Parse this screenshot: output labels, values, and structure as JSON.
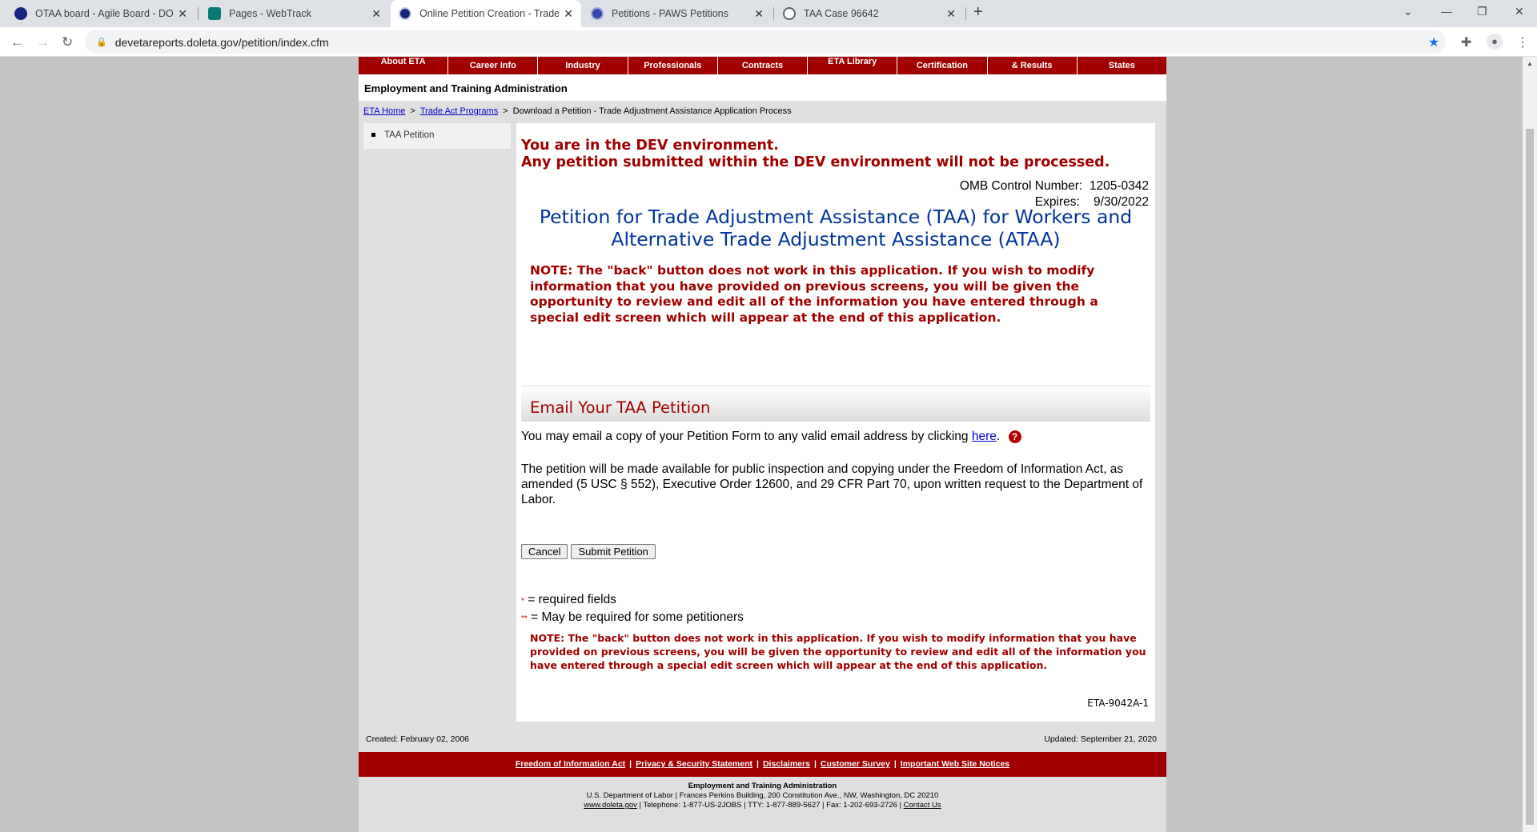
{
  "browser": {
    "tabs": [
      {
        "title": "OTAA board - Agile Board - DOL",
        "favicon_color": "#1a237e"
      },
      {
        "title": "Pages - WebTrack",
        "favicon_color": "#0b7a75"
      },
      {
        "title": "Online Petition Creation - Trade A",
        "favicon_color": "#1a237e"
      },
      {
        "title": "Petitions - PAWS Petitions",
        "favicon_color": "#3949ab"
      },
      {
        "title": "TAA Case 96642",
        "favicon_color": "#5f6368"
      }
    ],
    "close_glyph": "✕",
    "new_tab_glyph": "+",
    "url": "devetareports.doleta.gov/petition/index.cfm",
    "icons": {
      "back": "back-arrow-icon",
      "forward": "forward-arrow-icon",
      "reload": "reload-icon",
      "lock": "lock-icon",
      "star": "star-icon",
      "extensions": "puzzle-icon",
      "profile": "profile-icon",
      "menu": "kebab-menu-icon"
    }
  },
  "site": {
    "top_nav": [
      "About ETA",
      "Career Info",
      "Industry",
      "Professionals",
      "Contracts",
      "ETA Library",
      "Certification",
      "& Results",
      "States"
    ],
    "agency_name": "Employment and Training Administration",
    "breadcrumbs": {
      "home": "ETA Home",
      "programs": "Trade Act Programs",
      "current": "Download a Petition - Trade Adjustment Assistance Application Process",
      "separator": ">"
    },
    "left_nav": [
      "TAA Petition"
    ]
  },
  "content": {
    "dev_warning_1": "You are in the DEV environment.",
    "dev_warning_2": "Any petition submitted within the DEV environment will not be processed.",
    "omb_label": "OMB Control Number:",
    "omb_number": "1205-0342",
    "expires_label": "Expires:",
    "expires_date": "9/30/2022",
    "title_line1": "Petition for Trade Adjustment Assistance (TAA) for Workers and",
    "title_line2": "Alternative Trade Adjustment Assistance (ATAA)",
    "note": "NOTE: The \"back\" button does not work in this application. If you wish to modify information that you have provided on previous screens, you will be given the opportunity to review and edit all of the information you have entered through a special edit screen which will appear at the end of this application.",
    "email_header": "Email Your TAA Petition",
    "email_text": "You may email a copy of your Petition Form to any valid email address by clicking",
    "email_link": "here",
    "email_period": ".",
    "help_glyph": "?",
    "foia_text": "The petition will be made available for public inspection and copying under the Freedom of Information Act, as amended (5 USC § 552), Executive Order 12600, and 29 CFR Part 70, upon written request to the Department of Labor.",
    "cancel_label": "Cancel",
    "submit_label": "Submit Petition",
    "required_marker": "*",
    "required_text": "= required fields",
    "maybe_marker": "**",
    "maybe_text": "= May be required for some petitioners",
    "note_bottom": "NOTE: The \"back\" button does not work in this application. If you wish to modify information that you have provided on previous screens, you will be given the opportunity to review and edit all of the information you have entered through a special edit screen which will appear at the end of this application.",
    "form_id": "ETA-9042A-1"
  },
  "footer": {
    "created": "Created: February 02, 2006",
    "updated": "Updated: September 21, 2020",
    "links": [
      "Freedom of Information Act",
      "Privacy & Security Statement",
      "Disclaimers",
      "Customer Survey",
      "Important Web Site Notices"
    ],
    "link_separator": "|",
    "org": "Employment and Training Administration",
    "address": "U.S. Department of Labor | Frances Perkins Building, 200 Constitution Ave., NW, Washington, DC 20210",
    "site_link": "www.doleta.gov",
    "phones": " | Telephone: 1-877-US-2JOBS | TTY: 1-877-889-5627 | Fax: 1-202-693-2726 | ",
    "contact_link": "Contact Us"
  },
  "colors": {
    "brand_red": "#a00000",
    "title_blue": "#003399",
    "link_blue": "#0000cc"
  }
}
